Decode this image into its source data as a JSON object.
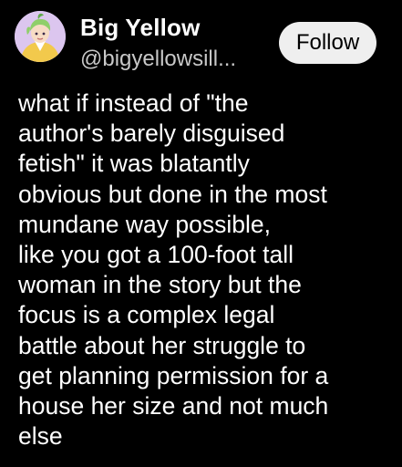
{
  "author": {
    "display_name": "Big Yellow",
    "handle": "@bigyellowsill...",
    "avatar_icon": "profile-avatar-illustration"
  },
  "actions": {
    "follow_label": "Follow"
  },
  "post": {
    "text": "what if instead of \"the\nauthor's barely disguised\nfetish\" it was blatantly\nobvious but done in the most\nmundane way possible,\nlike you got a 100-foot tall\nwoman in the story but the\nfocus is a complex legal\nbattle about her struggle to\nget planning permission for a\nhouse her size and not much\nelse"
  },
  "colors": {
    "background": "#000000",
    "text": "#ffffff",
    "handle_text": "#c8c8c8",
    "follow_button_bg": "#efefef",
    "follow_button_text": "#000000"
  }
}
